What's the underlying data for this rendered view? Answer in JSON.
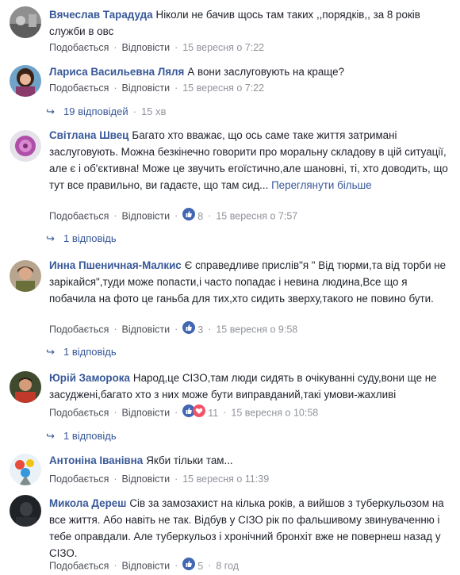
{
  "labels": {
    "like": "Подобається",
    "reply": "Відповісти",
    "see_more": "Переглянути більше"
  },
  "comments": [
    {
      "author": "Вячеслав Тарадуда",
      "text": "Ніколи не бачив щось там таких ,,порядків,, за 8 років служби в овс",
      "time": "15 вересня о 7:22"
    },
    {
      "author": "Лариса Васильевна Ляля",
      "text": "А вони заслуговують на краще?",
      "time": "15 вересня о 7:22",
      "replies": {
        "count": "19 відповідей",
        "ago": "15 хв"
      }
    },
    {
      "author": "Світлана Швец",
      "text": "Багато хто вважає, що ось саме таке життя затримані заслуговують. Можна безкінечно говорити про моральну складову в цій ситуації, але є і об'єктивна! Може це звучить егоїстично,але шановні, ті, хто доводить, що тут все правильно, ви гадаєте, що там сид...",
      "reactions": "8",
      "time": "15 вересня о 7:57",
      "replies": {
        "count": "1 відповідь"
      }
    },
    {
      "author": "Инна Пшеничная-Малкис",
      "text": "Є справедливе прислів\"я \" Від тюрми,та від торби не зарікайся\",туди може попасти,і часто попадає і невина людина,Все що я побачила на фото це ганьба для тих,хто сидить зверху,такого не повино бути.",
      "reactions": "3",
      "time": "15 вересня о 9:58",
      "replies": {
        "count": "1 відповідь"
      }
    },
    {
      "author": "Юрій Заморока",
      "text": "Народ,це СІЗО,там люди сидять в очікуванні суду,вони ще не засуджені,багато хто з них може бути виправданий,такі умови-жахливі",
      "reactions": "11",
      "time": "15 вересня о 10:58",
      "replies": {
        "count": "1 відповідь"
      }
    },
    {
      "author": "Антоніна Іванівна",
      "text": "Якби тільки там...",
      "time": "15 вересня о 11:39"
    },
    {
      "author": "Микола Дереш",
      "text": "Сів за замозахист на кілька років, а вийшов з туберкульозом на все життя. Або навіть не так. Відбув у СІЗО рік по фальшивому звинуваченню і тебе оправдали. Але туберкульоз і хронічний бронхіт вже не повернеш назад у СІЗО.",
      "reactions": "5",
      "time": "8 год"
    }
  ],
  "icons": {
    "like": "like-reaction-icon",
    "love": "love-reaction-icon",
    "reply_arrow": "reply-arrow-icon"
  },
  "colors": {
    "link": "#385898",
    "meta": "#90949c",
    "text": "#1d2129",
    "like_blue": "#4267b2",
    "love_red": "#f25268"
  }
}
